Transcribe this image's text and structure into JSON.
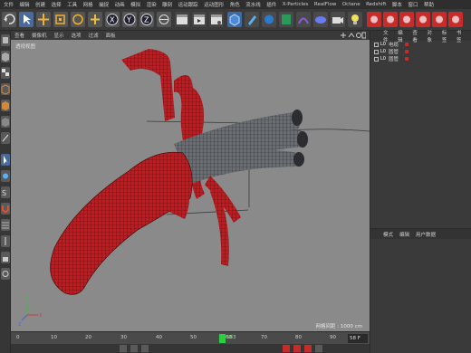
{
  "menubar": {
    "items": [
      "文件",
      "编辑",
      "创建",
      "选择",
      "工具",
      "网格",
      "捕捉",
      "动画",
      "模拟",
      "渲染",
      "雕刻",
      "运动跟踪",
      "运动图形",
      "角色",
      "流水线",
      "插件",
      "X-Particles",
      "RealFlow",
      "Octane",
      "Redshift",
      "脚本",
      "窗口",
      "帮助"
    ]
  },
  "viewport": {
    "menu": [
      "查看",
      "摄像机",
      "显示",
      "选项",
      "过滤",
      "面板"
    ],
    "label": "透视视图",
    "grid_spacing": "网格间距 : 1000 cm"
  },
  "timeline": {
    "ticks": [
      "0",
      "10",
      "20",
      "30",
      "40",
      "50",
      "60",
      "70",
      "80",
      "90"
    ],
    "current_frame_label": "583",
    "frame_field": "58 F"
  },
  "object_manager": {
    "menu": [
      "文件",
      "编辑",
      "查看",
      "对象",
      "标签",
      "书签"
    ],
    "objects": [
      {
        "layer": "L0",
        "name": "电缆"
      },
      {
        "layer": "L0",
        "name": "圆管"
      },
      {
        "layer": "L0",
        "name": "圆管"
      }
    ]
  },
  "attribute_manager": {
    "menu": [
      "模式",
      "编辑",
      "用户数据"
    ]
  },
  "colors": {
    "accent_red": "#c92a2a",
    "current_frame": "#2ecc40",
    "viewport_bg": "#8a8a8a"
  }
}
